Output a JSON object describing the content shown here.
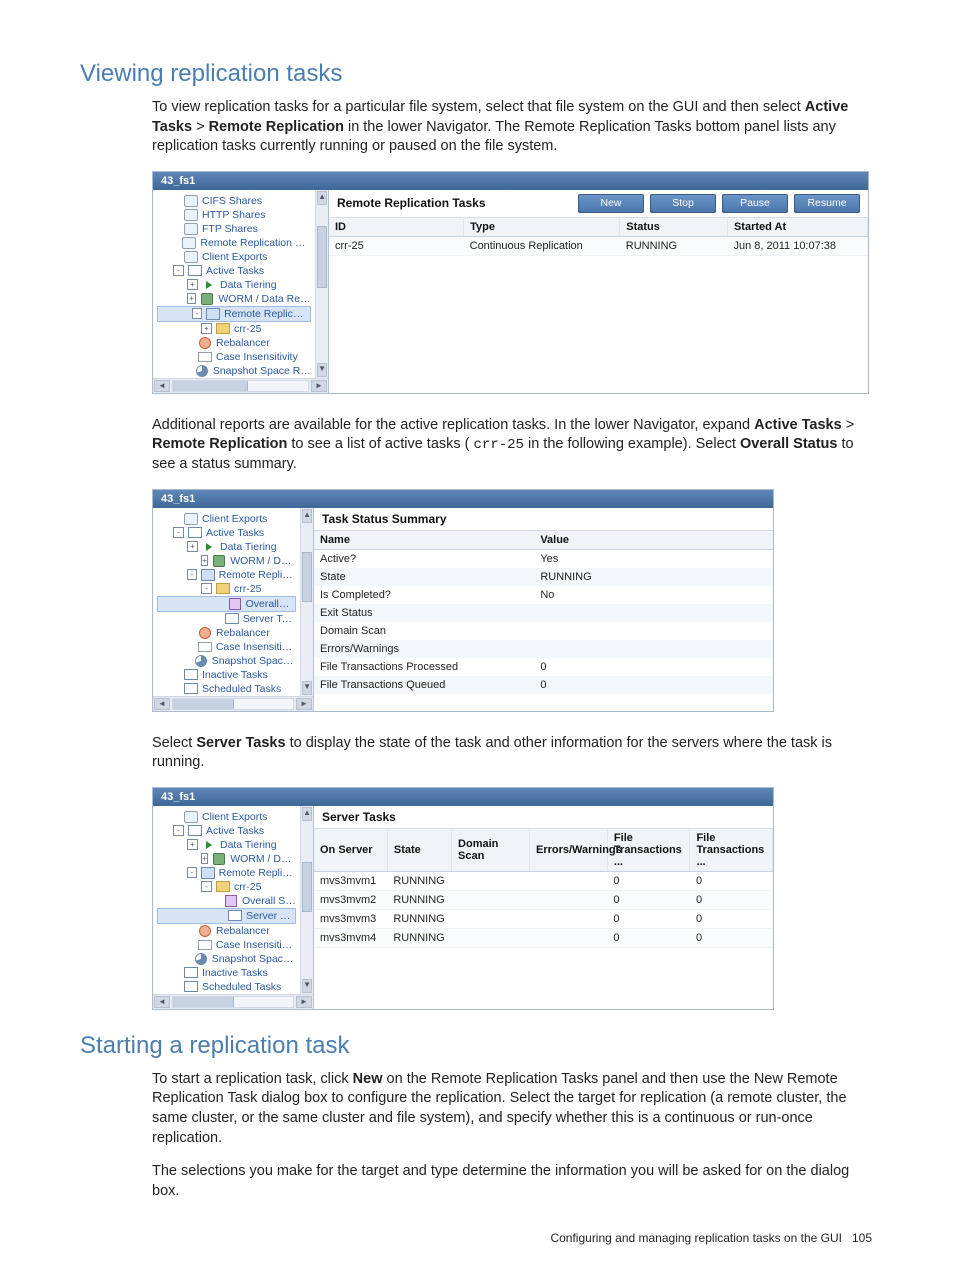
{
  "headings": {
    "viewing": "Viewing replication tasks",
    "starting": "Starting a replication task"
  },
  "para": {
    "p1a": "To view replication tasks for a particular file system, select that file system on the GUI and then select ",
    "p1b": "Active Tasks",
    "p1c": " > ",
    "p1d": "Remote Replication",
    "p1e": " in the lower Navigator. The Remote Replication Tasks bottom panel lists any replication tasks currently running or paused on the file system.",
    "p2a": "Additional reports are available for the active replication tasks. In the lower Navigator, expand ",
    "p2b": "Active Tasks",
    "p2c": " > ",
    "p2d": "Remote Replication",
    "p2e": " to see a list of active tasks (",
    "p2code": "crr-25",
    "p2f": " in the following example). Select ",
    "p2g": "Overall Status",
    "p2h": " to see a status summary.",
    "p3a": "Select ",
    "p3b": "Server Tasks",
    "p3c": " to display the state of the task and other information for the servers where the task is running.",
    "p4a": "To start a replication task, click ",
    "p4b": "New",
    "p4c": " on the Remote Replication Tasks panel and then use the New Remote Replication Task dialog box to configure the replication. Select the target for replication (a remote cluster, the same cluster, or the same cluster and file system), and specify whether this is a continuous or run-once replication.",
    "p5": "The selections you make for the target and type determine the information you will be asked for on the dialog box."
  },
  "shot1": {
    "title": "43_fs1",
    "nav": [
      {
        "label": "CIFS Shares",
        "icon": "share",
        "depth": 1
      },
      {
        "label": "HTTP Shares",
        "icon": "share",
        "depth": 1
      },
      {
        "label": "FTP Shares",
        "icon": "share",
        "depth": 1
      },
      {
        "label": "Remote Replication Exports",
        "icon": "share",
        "depth": 1
      },
      {
        "label": "Client Exports",
        "icon": "share",
        "depth": 1
      },
      {
        "label": "Active Tasks",
        "icon": "task",
        "depth": 1,
        "exp": "-"
      },
      {
        "label": "Data Tiering",
        "icon": "arrow",
        "depth": 2,
        "exp": "+"
      },
      {
        "label": "WORM / Data Retention",
        "icon": "worm",
        "depth": 2,
        "exp": "+"
      },
      {
        "label": "Remote Replication",
        "icon": "rr",
        "depth": 2,
        "exp": "-",
        "sel": true
      },
      {
        "label": "crr-25",
        "icon": "folder",
        "depth": 3,
        "exp": "+"
      },
      {
        "label": "Rebalancer",
        "icon": "reb",
        "depth": 2
      },
      {
        "label": "Case Insensitivity",
        "icon": "case",
        "depth": 2
      },
      {
        "label": "Snapshot Space Reclamation",
        "icon": "pie",
        "depth": 2
      }
    ],
    "pane_title": "Remote Replication Tasks",
    "buttons": [
      "New",
      "Stop",
      "Pause",
      "Resume"
    ],
    "cols": [
      "ID",
      "Type",
      "Status",
      "Started At"
    ],
    "rows": [
      {
        "id": "crr-25",
        "type": "Continuous Replication",
        "status": "RUNNING",
        "started": "Jun 8, 2011 10:07:38"
      }
    ]
  },
  "shot2": {
    "title": "43_fs1",
    "nav": [
      {
        "label": "Client Exports",
        "icon": "share",
        "depth": 1
      },
      {
        "label": "Active Tasks",
        "icon": "task",
        "depth": 1,
        "exp": "-"
      },
      {
        "label": "Data Tiering",
        "icon": "arrow",
        "depth": 2,
        "exp": "+"
      },
      {
        "label": "WORM / Data Retention",
        "icon": "worm",
        "depth": 3,
        "exp": "+"
      },
      {
        "label": "Remote Replication",
        "icon": "rr",
        "depth": 2,
        "exp": "-"
      },
      {
        "label": "crr-25",
        "icon": "folder",
        "depth": 3,
        "exp": "-"
      },
      {
        "label": "Overall Status",
        "icon": "status",
        "depth": 4,
        "sel": true
      },
      {
        "label": "Server Tasks",
        "icon": "task",
        "depth": 4
      },
      {
        "label": "Rebalancer",
        "icon": "reb",
        "depth": 2
      },
      {
        "label": "Case Insensitivity",
        "icon": "case",
        "depth": 2
      },
      {
        "label": "Snapshot Space Reclamation",
        "icon": "pie",
        "depth": 2
      },
      {
        "label": "Inactive Tasks",
        "icon": "task",
        "depth": 1
      },
      {
        "label": "Scheduled Tasks",
        "icon": "task",
        "depth": 1
      }
    ],
    "pane_title": "Task Status Summary",
    "nv_cols": [
      "Name",
      "Value"
    ],
    "nv": [
      {
        "n": "Active?",
        "v": "Yes"
      },
      {
        "n": "State",
        "v": "RUNNING"
      },
      {
        "n": "Is Completed?",
        "v": "No"
      },
      {
        "n": "Exit Status",
        "v": ""
      },
      {
        "n": "Domain Scan",
        "v": ""
      },
      {
        "n": "Errors/Warnings",
        "v": ""
      },
      {
        "n": "File Transactions Processed",
        "v": "0"
      },
      {
        "n": "File Transactions Queued",
        "v": "0"
      }
    ]
  },
  "shot3": {
    "title": "43_fs1",
    "nav": [
      {
        "label": "Client Exports",
        "icon": "share",
        "depth": 1
      },
      {
        "label": "Active Tasks",
        "icon": "task",
        "depth": 1,
        "exp": "-"
      },
      {
        "label": "Data Tiering",
        "icon": "arrow",
        "depth": 2,
        "exp": "+"
      },
      {
        "label": "WORM / Data Retention",
        "icon": "worm",
        "depth": 3,
        "exp": "+"
      },
      {
        "label": "Remote Replication",
        "icon": "rr",
        "depth": 2,
        "exp": "-"
      },
      {
        "label": "crr-25",
        "icon": "folder",
        "depth": 3,
        "exp": "-"
      },
      {
        "label": "Overall Status",
        "icon": "status",
        "depth": 4
      },
      {
        "label": "Server Tasks",
        "icon": "task",
        "depth": 4,
        "sel": true
      },
      {
        "label": "Rebalancer",
        "icon": "reb",
        "depth": 2
      },
      {
        "label": "Case Insensitivity",
        "icon": "case",
        "depth": 2
      },
      {
        "label": "Snapshot Space Reclamation",
        "icon": "pie",
        "depth": 2
      },
      {
        "label": "Inactive Tasks",
        "icon": "task",
        "depth": 1
      },
      {
        "label": "Scheduled Tasks",
        "icon": "task",
        "depth": 1
      }
    ],
    "pane_title": "Server Tasks",
    "cols": [
      "On Server",
      "State",
      "Domain Scan",
      "Errors/Warnings",
      "File Transactions ...",
      "File Transactions ..."
    ],
    "rows": [
      {
        "srv": "mvs3mvm1",
        "state": "RUNNING",
        "ds": "",
        "ew": "",
        "fp": "0",
        "fq": "0"
      },
      {
        "srv": "mvs3mvm2",
        "state": "RUNNING",
        "ds": "",
        "ew": "",
        "fp": "0",
        "fq": "0"
      },
      {
        "srv": "mvs3mvm3",
        "state": "RUNNING",
        "ds": "",
        "ew": "",
        "fp": "0",
        "fq": "0"
      },
      {
        "srv": "mvs3mvm4",
        "state": "RUNNING",
        "ds": "",
        "ew": "",
        "fp": "0",
        "fq": "0"
      }
    ]
  },
  "footer": {
    "text": "Configuring and managing replication tasks on the GUI",
    "page": "105"
  }
}
